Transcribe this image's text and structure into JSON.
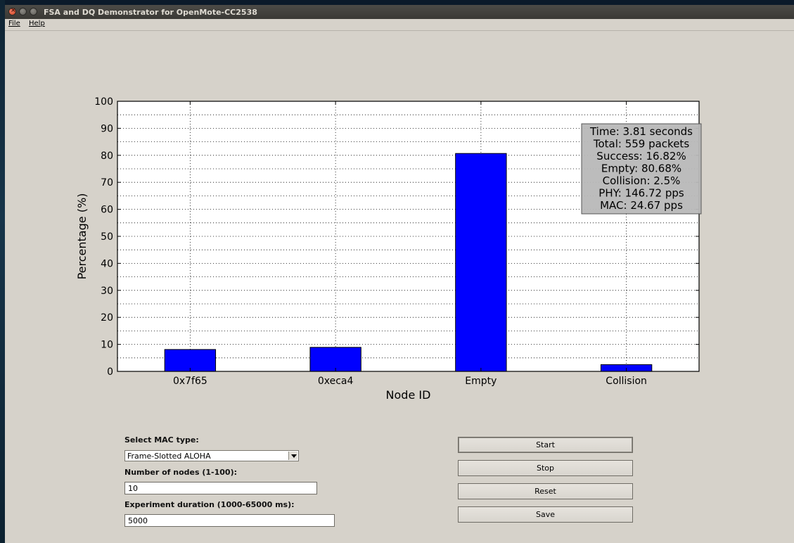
{
  "window": {
    "title": "FSA and DQ Demonstrator for OpenMote-CC2538"
  },
  "menu": [
    "File",
    "Help"
  ],
  "chart_data": {
    "type": "bar",
    "categories": [
      "0x7f65",
      "0xeca4",
      "Empty",
      "Collision"
    ],
    "values": [
      8.1,
      8.9,
      80.68,
      2.5
    ],
    "xlabel": "Node ID",
    "ylabel": "Percentage (%)",
    "ylim": [
      0,
      100
    ],
    "yticks": [
      0,
      10,
      20,
      30,
      40,
      50,
      60,
      70,
      80,
      90,
      100
    ],
    "grid": true,
    "bar_color": "#0000ff",
    "annotation": [
      "Time: 3.81 seconds",
      "Total: 559 packets",
      "Success: 16.82%",
      "Empty: 80.68%",
      "Collision: 2.5%",
      "PHY: 146.72 pps",
      "MAC: 24.67 pps"
    ],
    "annotation_placement": "top-right"
  },
  "controls": {
    "mac_label": "Select MAC type:",
    "mac_value": "Frame-Slotted ALOHA",
    "nodes_label": "Number of nodes (1-100):",
    "nodes_value": "10",
    "duration_label": "Experiment duration (1000-65000 ms):",
    "duration_value": "5000",
    "start": "Start",
    "stop": "Stop",
    "reset": "Reset",
    "save": "Save"
  }
}
